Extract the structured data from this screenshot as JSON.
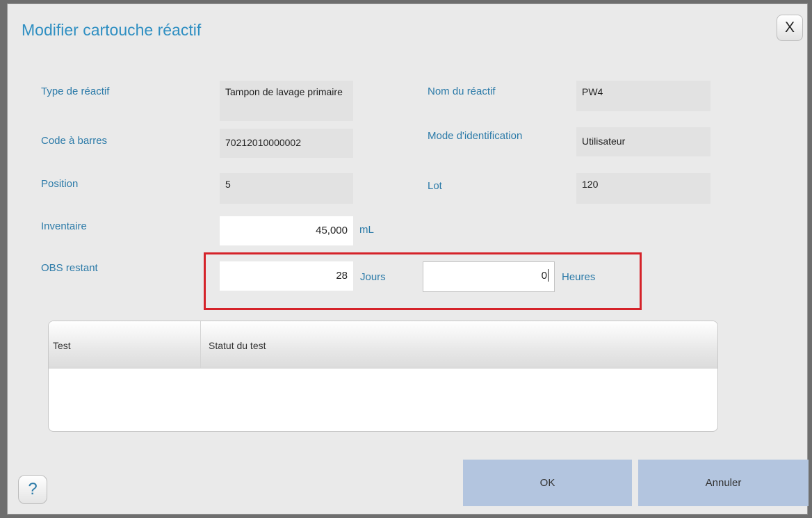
{
  "dialog": {
    "title": "Modifier cartouche réactif",
    "close_label": "X",
    "help_label": "?"
  },
  "fields": {
    "reagent_type": {
      "label": "Type de réactif",
      "value": "Tampon de lavage primaire"
    },
    "reagent_name": {
      "label": "Nom du réactif",
      "value": "PW4"
    },
    "barcode": {
      "label": "Code à barres",
      "value": "70212010000002"
    },
    "identification_mode": {
      "label": "Mode d'identification",
      "value": "Utilisateur"
    },
    "position": {
      "label": "Position",
      "value": "5"
    },
    "lot": {
      "label": "Lot",
      "value": "120"
    },
    "inventory": {
      "label": "Inventaire",
      "value": "45,000",
      "unit": "mL"
    },
    "obs_remaining": {
      "label": "OBS restant",
      "days_value": "28",
      "days_unit": "Jours",
      "hours_value": "0",
      "hours_unit": "Heures"
    }
  },
  "table": {
    "columns": [
      "Test",
      "Statut du test"
    ],
    "rows": []
  },
  "buttons": {
    "ok": "OK",
    "cancel": "Annuler"
  },
  "colors": {
    "title": "#2f8fc2",
    "label": "#2b7aa8",
    "highlight": "#d5232a",
    "button": "#b3c5df"
  }
}
